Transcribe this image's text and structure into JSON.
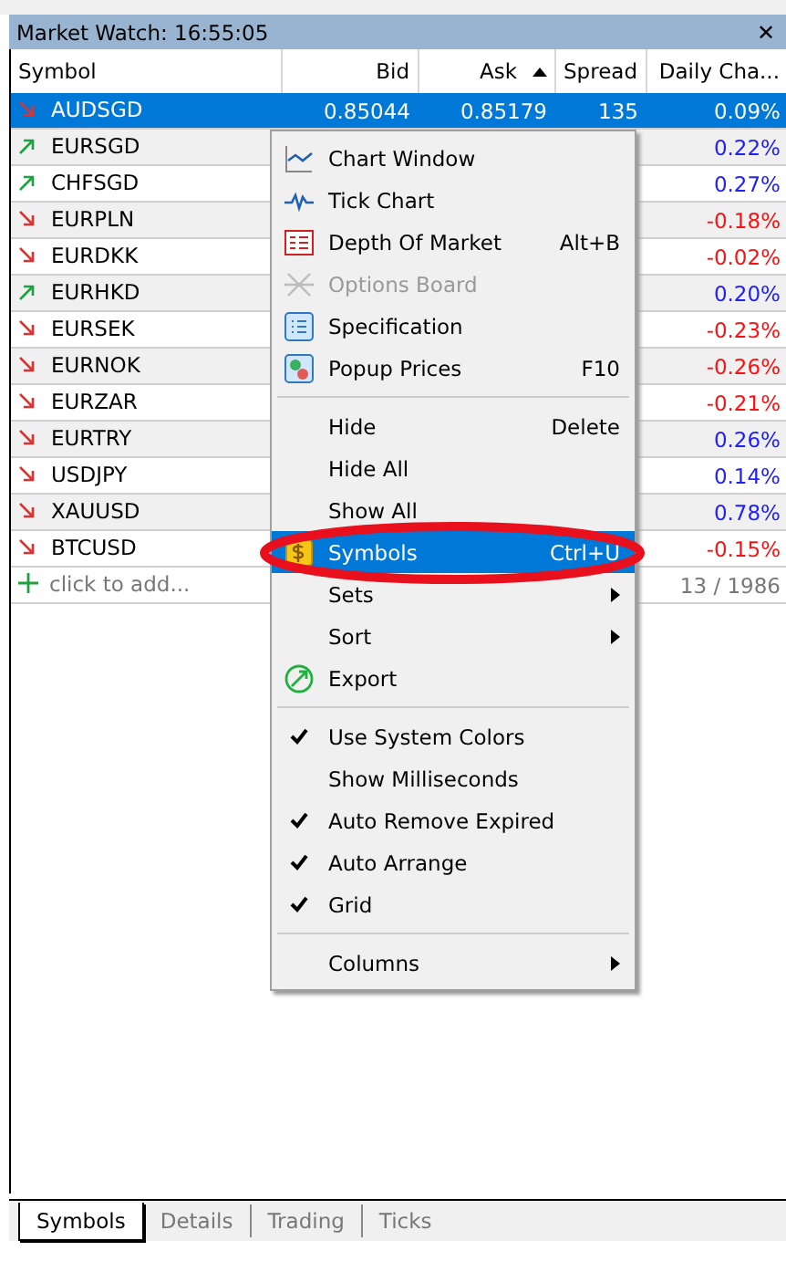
{
  "window": {
    "title": "Market Watch: 16:55:05",
    "close": "✕"
  },
  "table": {
    "columns": [
      {
        "label": "Symbol",
        "sorted": false
      },
      {
        "label": "Bid",
        "sorted": false
      },
      {
        "label": "Ask",
        "sorted": true
      },
      {
        "label": "Spread",
        "sorted": false
      },
      {
        "label": "Daily Cha...",
        "sorted": false
      }
    ],
    "rows": [
      {
        "symbol": "AUDSGD",
        "bid": "0.85044",
        "ask": "0.85179",
        "spread": "135",
        "change": "0.09%",
        "trend_up": false,
        "change_positive": true,
        "selected": true
      },
      {
        "symbol": "EURSGD",
        "change": "0.22%",
        "trend_up": true,
        "change_positive": true,
        "selected": false
      },
      {
        "symbol": "CHFSGD",
        "change": "0.27%",
        "trend_up": true,
        "change_positive": true,
        "selected": false
      },
      {
        "symbol": "EURPLN",
        "change": "-0.18%",
        "trend_up": false,
        "change_positive": false,
        "selected": false
      },
      {
        "symbol": "EURDKK",
        "change": "-0.02%",
        "trend_up": false,
        "change_positive": false,
        "selected": false
      },
      {
        "symbol": "EURHKD",
        "change": "0.20%",
        "trend_up": true,
        "change_positive": true,
        "selected": false
      },
      {
        "symbol": "EURSEK",
        "change": "-0.23%",
        "trend_up": false,
        "change_positive": false,
        "selected": false
      },
      {
        "symbol": "EURNOK",
        "change": "-0.26%",
        "trend_up": false,
        "change_positive": false,
        "selected": false
      },
      {
        "symbol": "EURZAR",
        "change": "-0.21%",
        "trend_up": false,
        "change_positive": false,
        "selected": false
      },
      {
        "symbol": "EURTRY",
        "change": "0.26%",
        "trend_up": false,
        "change_positive": true,
        "selected": false
      },
      {
        "symbol": "USDJPY",
        "change": "0.14%",
        "trend_up": false,
        "change_positive": true,
        "selected": false
      },
      {
        "symbol": "XAUUSD",
        "change": "0.78%",
        "trend_up": false,
        "change_positive": true,
        "selected": false
      },
      {
        "symbol": "BTCUSD",
        "change": "-0.15%",
        "trend_up": false,
        "change_positive": false,
        "selected": false
      }
    ],
    "add_row": {
      "placeholder": "click to add...",
      "count": "13 / 1986"
    }
  },
  "context_menu": [
    {
      "kind": "item",
      "label": "Chart Window",
      "disabled": false,
      "selected": false
    },
    {
      "kind": "item",
      "label": "Tick Chart",
      "disabled": false,
      "selected": false
    },
    {
      "kind": "item",
      "label": "Depth Of Market",
      "shortcut": "Alt+B",
      "disabled": false,
      "selected": false
    },
    {
      "kind": "item",
      "label": "Options Board",
      "disabled": true,
      "selected": false
    },
    {
      "kind": "item",
      "label": "Specification",
      "disabled": false,
      "selected": false
    },
    {
      "kind": "item",
      "label": "Popup Prices",
      "shortcut": "F10",
      "disabled": false,
      "selected": false
    },
    {
      "kind": "separator"
    },
    {
      "kind": "item",
      "label": "Hide",
      "shortcut": "Delete",
      "disabled": false,
      "selected": false
    },
    {
      "kind": "item",
      "label": "Hide All",
      "disabled": false,
      "selected": false
    },
    {
      "kind": "item",
      "label": "Show All",
      "disabled": false,
      "selected": false
    },
    {
      "kind": "item",
      "label": "Symbols",
      "shortcut": "Ctrl+U",
      "disabled": false,
      "selected": true,
      "highlighted": true
    },
    {
      "kind": "item",
      "label": "Sets",
      "submenu": true,
      "disabled": false,
      "selected": false
    },
    {
      "kind": "item",
      "label": "Sort",
      "submenu": true,
      "disabled": false,
      "selected": false
    },
    {
      "kind": "item",
      "label": "Export",
      "disabled": false,
      "selected": false
    },
    {
      "kind": "separator"
    },
    {
      "kind": "check",
      "label": "Use System Colors",
      "checked": true,
      "selected": false
    },
    {
      "kind": "check",
      "label": "Show Milliseconds",
      "checked": false,
      "selected": false
    },
    {
      "kind": "check",
      "label": "Auto Remove Expired",
      "checked": true,
      "selected": false
    },
    {
      "kind": "check",
      "label": "Auto Arrange",
      "checked": true,
      "selected": false
    },
    {
      "kind": "check",
      "label": "Grid",
      "checked": true,
      "selected": false
    },
    {
      "kind": "separator"
    },
    {
      "kind": "item",
      "label": "Columns",
      "submenu": true,
      "disabled": false,
      "selected": false
    }
  ],
  "tabs": [
    {
      "label": "Symbols",
      "selected": true
    },
    {
      "label": "Details",
      "selected": false
    },
    {
      "label": "Trading",
      "selected": false
    },
    {
      "label": "Ticks",
      "selected": false
    }
  ]
}
